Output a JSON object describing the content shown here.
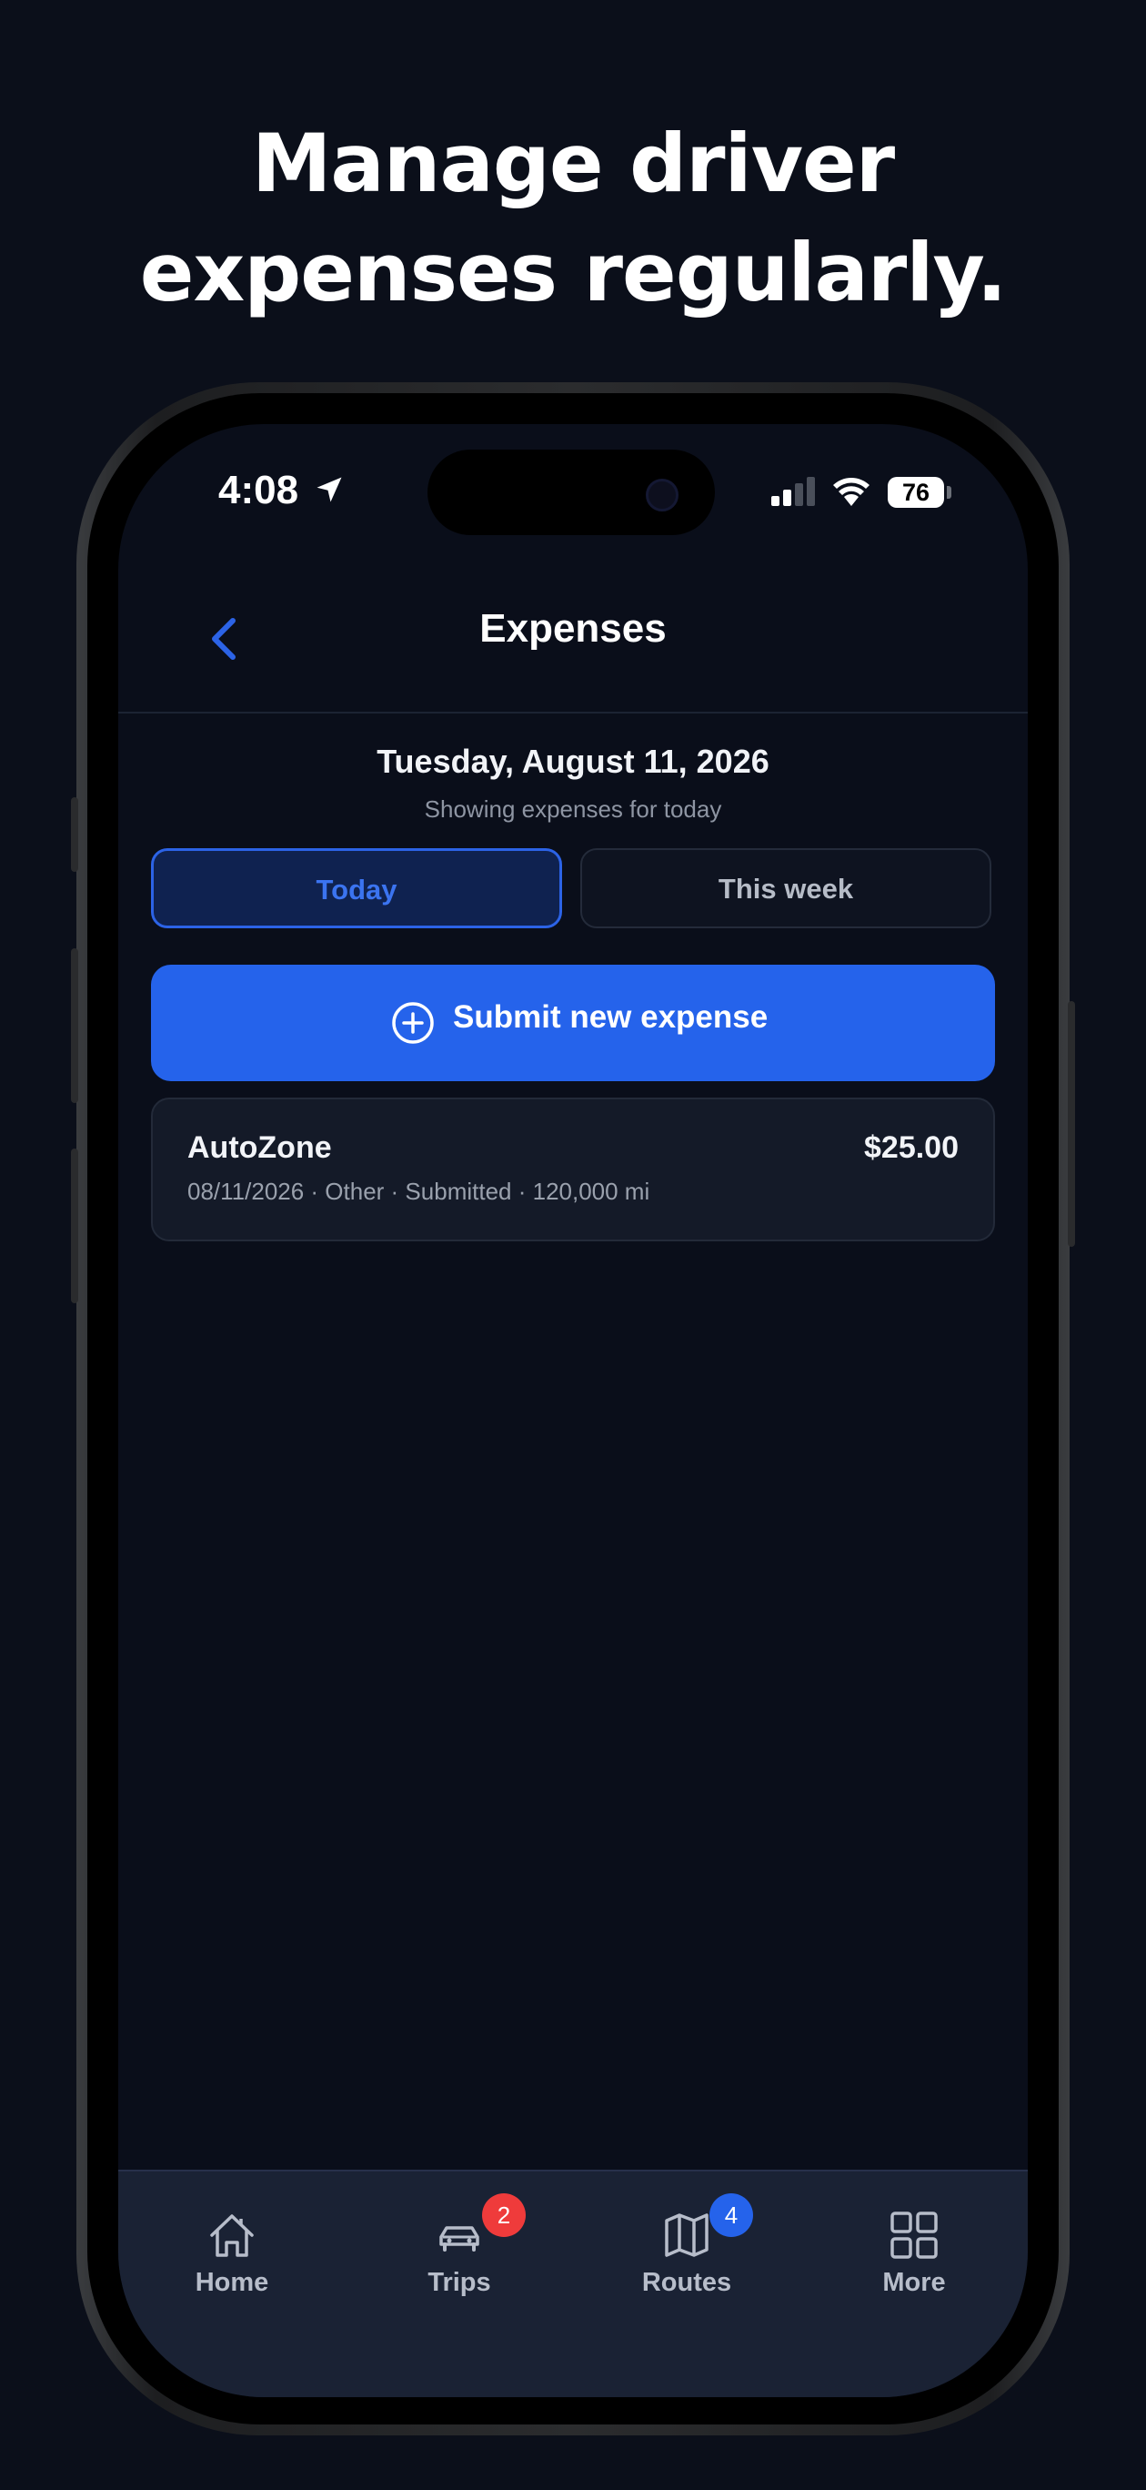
{
  "headline": {
    "line1": "Manage driver",
    "line2": "expenses regularly."
  },
  "status_bar": {
    "time": "4:08",
    "battery": "76"
  },
  "nav": {
    "title": "Expenses"
  },
  "date_header": {
    "date": "Tuesday, August 11, 2026",
    "subtitle": "Showing expenses for today"
  },
  "filter_tabs": {
    "today": "Today",
    "this_week": "This week",
    "selected": "Today"
  },
  "submit_button": {
    "label": "Submit new expense"
  },
  "expenses": [
    {
      "vendor": "AutoZone",
      "amount": "$25.00",
      "meta": "08/11/2026 · Other · Submitted · 120,000 mi"
    }
  ],
  "tab_bar": {
    "items": [
      {
        "label": "Home",
        "icon": "home-icon"
      },
      {
        "label": "Trips",
        "icon": "car-icon",
        "badge": "2",
        "badge_color": "#ef3b3b"
      },
      {
        "label": "Routes",
        "icon": "map-icon",
        "badge": "4",
        "badge_color": "#2563eb"
      },
      {
        "label": "More",
        "icon": "grid-icon"
      }
    ]
  },
  "colors": {
    "background": "#0a0e1a",
    "accent": "#2563eb",
    "badge_red": "#ef3b3b"
  }
}
